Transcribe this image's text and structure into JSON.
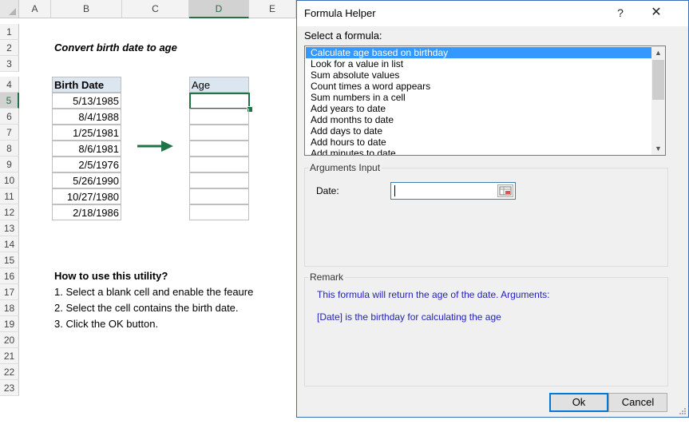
{
  "sheet": {
    "columns": [
      "A",
      "B",
      "C",
      "D",
      "E"
    ],
    "rows": [
      "1",
      "2",
      "3",
      "4",
      "5",
      "6",
      "7",
      "8",
      "9",
      "10",
      "11",
      "12",
      "13",
      "14",
      "15",
      "16",
      "17",
      "18",
      "19",
      "20",
      "21",
      "22",
      "23"
    ],
    "title": "Convert birth date to age",
    "birth_header": "Birth Date",
    "age_header": "Age",
    "birth_dates": [
      "5/13/1985",
      "8/4/1988",
      "1/25/1981",
      "8/6/1981",
      "2/5/1976",
      "5/26/1990",
      "10/27/1980",
      "2/18/1986"
    ],
    "instructions_title": "How to use this utility?",
    "instructions": [
      "1. Select a blank cell and enable the feaure",
      "2. Select the cell contains the birth date.",
      "3. Click the OK button."
    ],
    "arrow_color": "#217346"
  },
  "dialog": {
    "title": "Formula Helper",
    "help_label": "?",
    "close_label": "✕",
    "select_label": "Select a formula:",
    "formulas": [
      "Calculate age based on birthday",
      "Look for a value in list",
      "Sum absolute values",
      "Count times a word appears",
      "Sum numbers in a cell",
      "Add years to date",
      "Add months to date",
      "Add days to date",
      "Add hours to date",
      "Add minutes to date"
    ],
    "arguments_title": "Arguments Input",
    "date_label": "Date:",
    "date_value": "",
    "remark_title": "Remark",
    "remark_lines": [
      "This formula will return the age of the date. Arguments:",
      "[Date] is the birthday for calculating the age"
    ],
    "ok_label": "Ok",
    "cancel_label": "Cancel"
  }
}
